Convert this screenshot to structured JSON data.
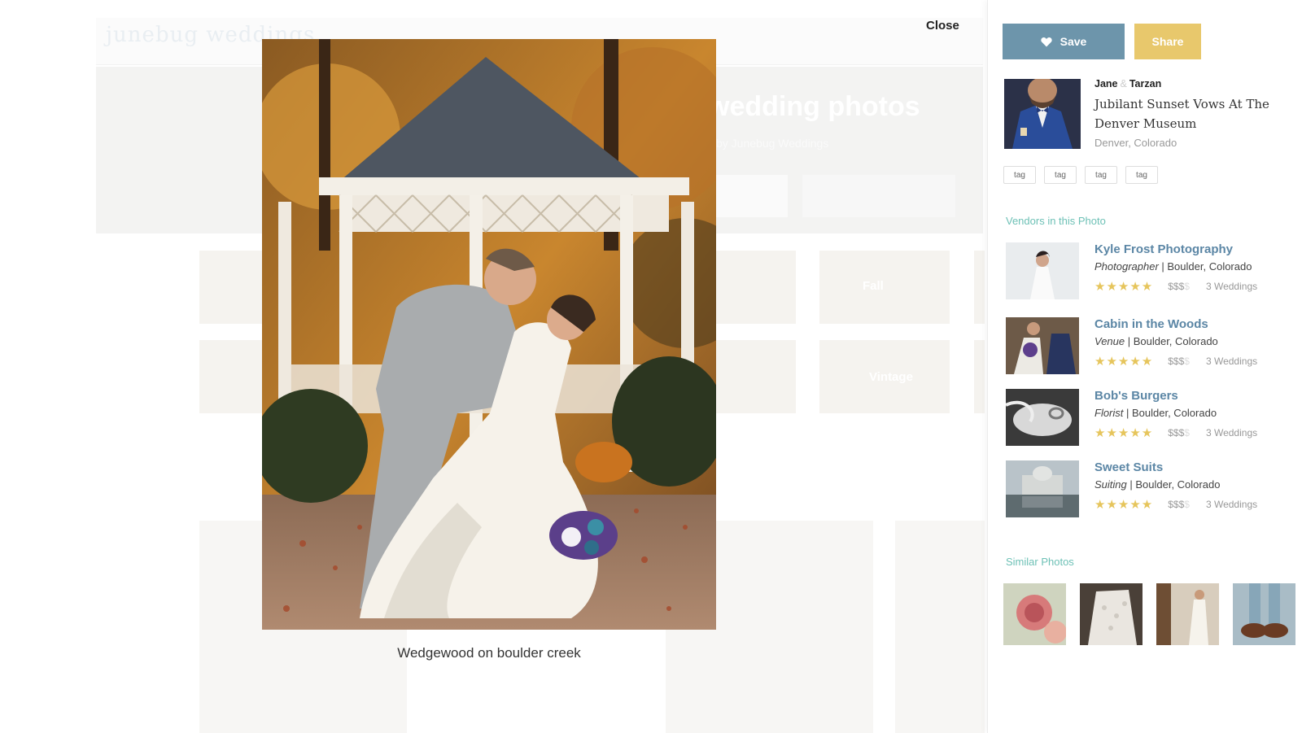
{
  "background": {
    "logo": "junebug weddings",
    "hero_title": "wedding photos",
    "hero_subtitle": "by Junebug Weddings",
    "tile_labels": [
      "Fall",
      "Fall",
      "Vintage"
    ]
  },
  "modal": {
    "close_label": "Close",
    "caption": "Wedgewood on boulder creek"
  },
  "panel": {
    "save_label": "Save",
    "share_label": "Share",
    "wedding": {
      "partner1": "Jane",
      "ampersand": "&",
      "partner2": "Tarzan",
      "title": "Jubilant Sunset Vows At The Denver Museum",
      "location": "Denver, Colorado"
    },
    "tags": [
      "tag",
      "tag",
      "tag",
      "tag"
    ],
    "vendors_title": "Vendors in this Photo",
    "vendors": [
      {
        "name": "Kyle Frost Photography",
        "type": "Photographer",
        "location": " | Boulder, Colorado",
        "rating": 5,
        "price_on": "$$$",
        "price_off": "$",
        "weddings": "3 Weddings"
      },
      {
        "name": "Cabin in the Woods",
        "type": "Venue",
        "location": " | Boulder, Colorado",
        "rating": 5,
        "price_on": "$$$",
        "price_off": "$",
        "weddings": "3 Weddings"
      },
      {
        "name": "Bob's Burgers",
        "type": "Florist",
        "location": " | Boulder, Colorado",
        "rating": 5,
        "price_on": "$$$",
        "price_off": "$",
        "weddings": "3 Weddings"
      },
      {
        "name": "Sweet Suits",
        "type": "Suiting",
        "location": " | Boulder, Colorado",
        "rating": 5,
        "price_on": "$$$",
        "price_off": "$",
        "weddings": "3 Weddings"
      }
    ],
    "similar_title": "Similar Photos",
    "colors": {
      "save": "#6d95ab",
      "share": "#e8c86c",
      "section": "#6ec1b6",
      "vendor_link": "#5b86a5",
      "star": "#e6c55c"
    }
  }
}
